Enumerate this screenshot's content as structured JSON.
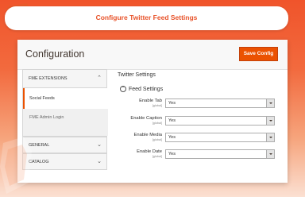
{
  "banner": {
    "title": "Configure Twitter Feed Settings"
  },
  "header": {
    "title": "Configuration",
    "save_label": "Save Config"
  },
  "sidebar": {
    "sections": [
      {
        "label": "FME EXTENSIONS",
        "expanded": true
      },
      {
        "label": "GENERAL",
        "expanded": false
      },
      {
        "label": "CATALOG",
        "expanded": false
      }
    ],
    "items": [
      {
        "label": "Social Feeds",
        "active": true
      },
      {
        "label": "FME Admin Login",
        "active": false
      }
    ]
  },
  "main": {
    "section_title": "Twitter Settings",
    "group_title": "Feed Settings",
    "rows": [
      {
        "label": "Enable Tab",
        "scope": "[global]",
        "value": "Yes"
      },
      {
        "label": "Enable Caption",
        "scope": "[global]",
        "value": "Yes"
      },
      {
        "label": "Enable Media",
        "scope": "[global]",
        "value": "Yes"
      },
      {
        "label": "Enable Date",
        "scope": "[global]",
        "value": "Yes"
      }
    ]
  },
  "colors": {
    "accent": "#eb5202",
    "banner_text": "#e8532a",
    "active_marker": "#eb5202"
  }
}
